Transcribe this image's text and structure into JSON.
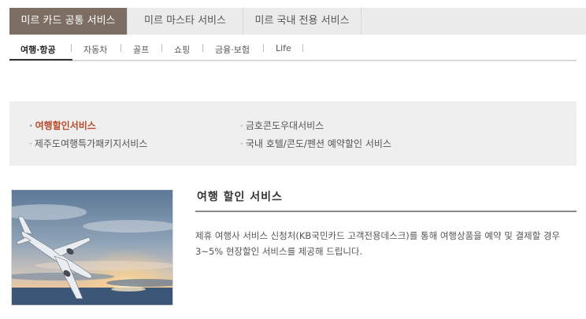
{
  "tabs": [
    {
      "label": "미르 카드 공통 서비스",
      "active": true
    },
    {
      "label": "미르 마스타 서비스",
      "active": false
    },
    {
      "label": "미르 국내 전용 서비스",
      "active": false
    }
  ],
  "subnav": [
    {
      "label": "여행·항공",
      "active": true
    },
    {
      "label": "자동차"
    },
    {
      "label": "골프"
    },
    {
      "label": "쇼핑"
    },
    {
      "label": "금융·보험"
    },
    {
      "label": "Life"
    }
  ],
  "services": {
    "bullet": "·",
    "travel_discount": "여행할인서비스",
    "jeju_package": "제주도여행특가패키지서비스",
    "kumho_condo": "금호콘도우대서비스",
    "domestic_hotel": "국내 호텔/콘도/펜션 예약할인 서비스"
  },
  "detail": {
    "title": "여행 할인 서비스",
    "description": "제휴 여행사 서비스 신청처(KB국민카드 고객전용데스크)를 통해 여행상품을 예약 및 결제할 경우 3~5% 현장할인 서비스를 제공해 드립니다."
  },
  "colors": {
    "active_tab": "#7d6e63",
    "tab_bg": "#ebebeb",
    "accent_red": "#b64a2a",
    "panel_bg": "#efefef"
  }
}
